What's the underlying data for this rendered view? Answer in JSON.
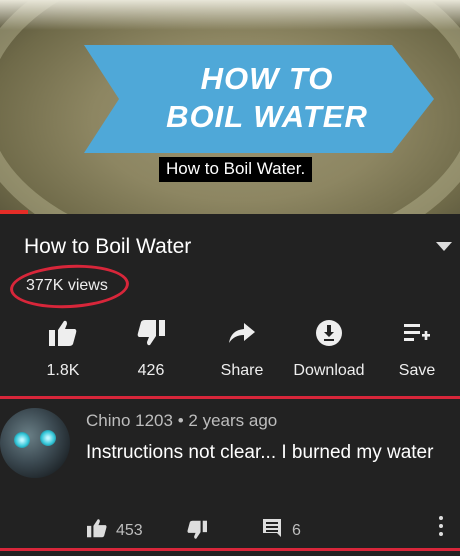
{
  "video": {
    "banner_line1": "HOW TO",
    "banner_line2": "BOIL WATER",
    "caption": "How to Boil Water."
  },
  "title": "How to Boil Water",
  "views": "377K views",
  "actions": {
    "like": "1.8K",
    "dislike": "426",
    "share": "Share",
    "download": "Download",
    "save": "Save"
  },
  "comment": {
    "author": "Chino 1203",
    "separator": "•",
    "time": "2 years ago",
    "text": "Instructions not clear... I burned my water",
    "likes": "453",
    "replies": "6"
  },
  "colors": {
    "background": "#222222",
    "accent_red": "#d8263a",
    "banner_blue": "#4fa8d8"
  },
  "icons": [
    "thumbs-up-icon",
    "thumbs-down-icon",
    "share-arrow-icon",
    "download-icon",
    "playlist-add-icon",
    "reply-icon",
    "more-vert-icon",
    "expand-chevron-icon"
  ]
}
